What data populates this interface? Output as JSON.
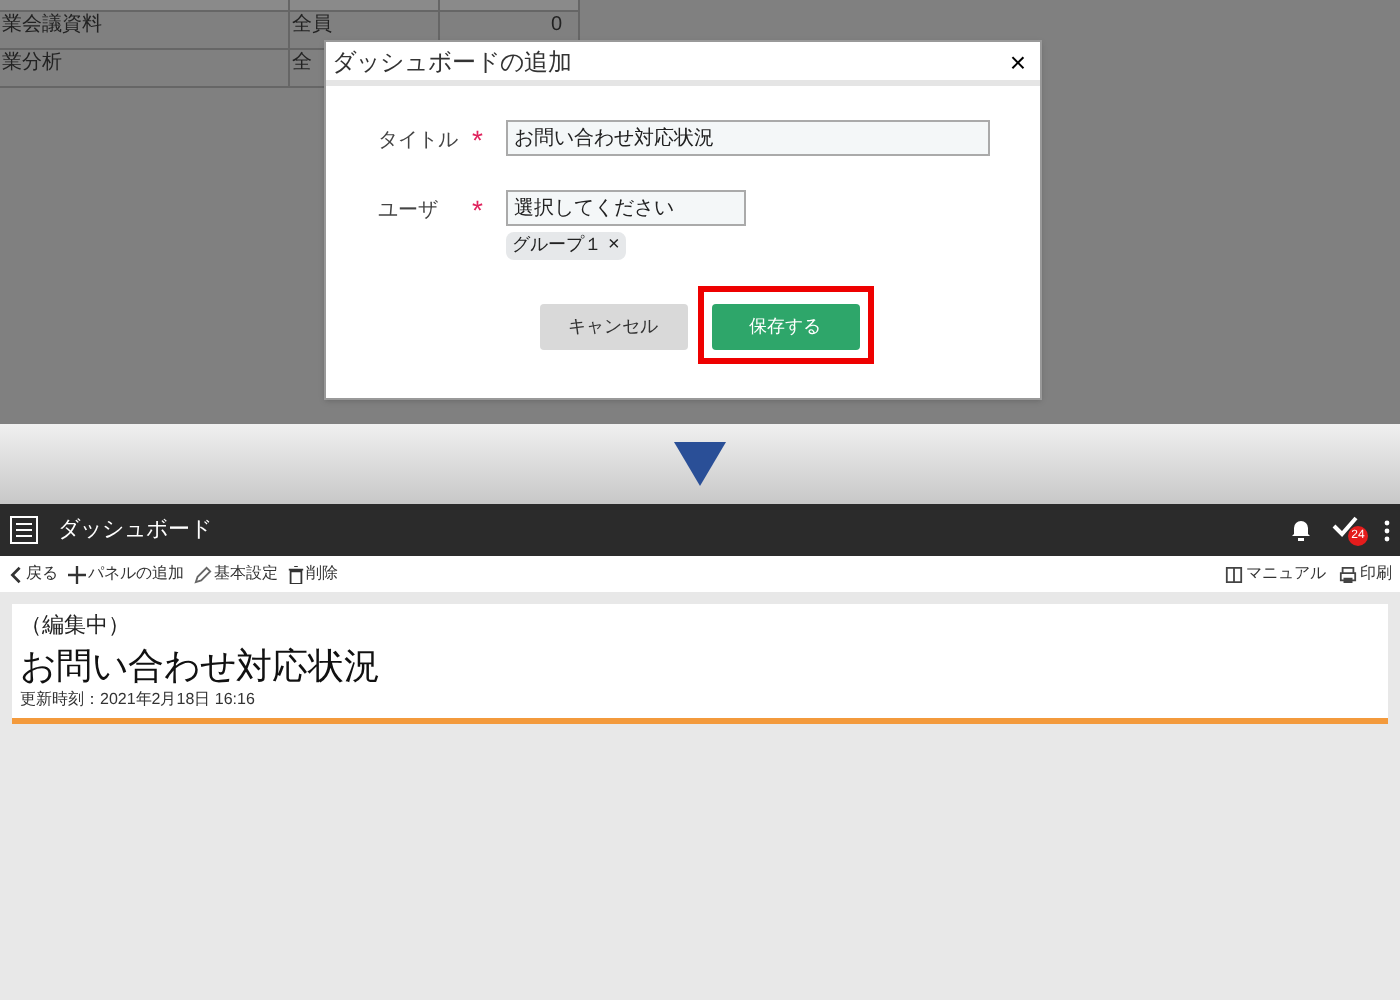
{
  "background_table": {
    "rows": [
      [
        "業会議資料",
        "全員",
        "0"
      ],
      [
        "業分析",
        "全",
        ""
      ]
    ]
  },
  "dialog": {
    "title": "ダッシュボードの追加",
    "close": "×",
    "fields": [
      {
        "label": "タイトル",
        "required_mark": "*",
        "value": "お問い合わせ対応状況"
      },
      {
        "label": "ユーザ",
        "required_mark": "*",
        "value": "選択してください",
        "tags": [
          {
            "label": "グループ１",
            "remove": "×"
          }
        ]
      }
    ],
    "buttons": [
      {
        "label": "キャンセル",
        "kind": "secondary",
        "highlighted": false
      },
      {
        "label": "保存する",
        "kind": "primary",
        "highlighted": true
      }
    ]
  },
  "app": {
    "title": "ダッシュボード",
    "task_badge": "24",
    "toolbar_left": [
      "戻る",
      "パネルの追加",
      "基本設定",
      "削除"
    ],
    "toolbar_right": [
      "マニュアル",
      "印刷"
    ],
    "card": {
      "status": "（編集中）",
      "title": "お問い合わせ対応状況",
      "updated": "更新時刻：2021年2月18日 16:16"
    }
  }
}
